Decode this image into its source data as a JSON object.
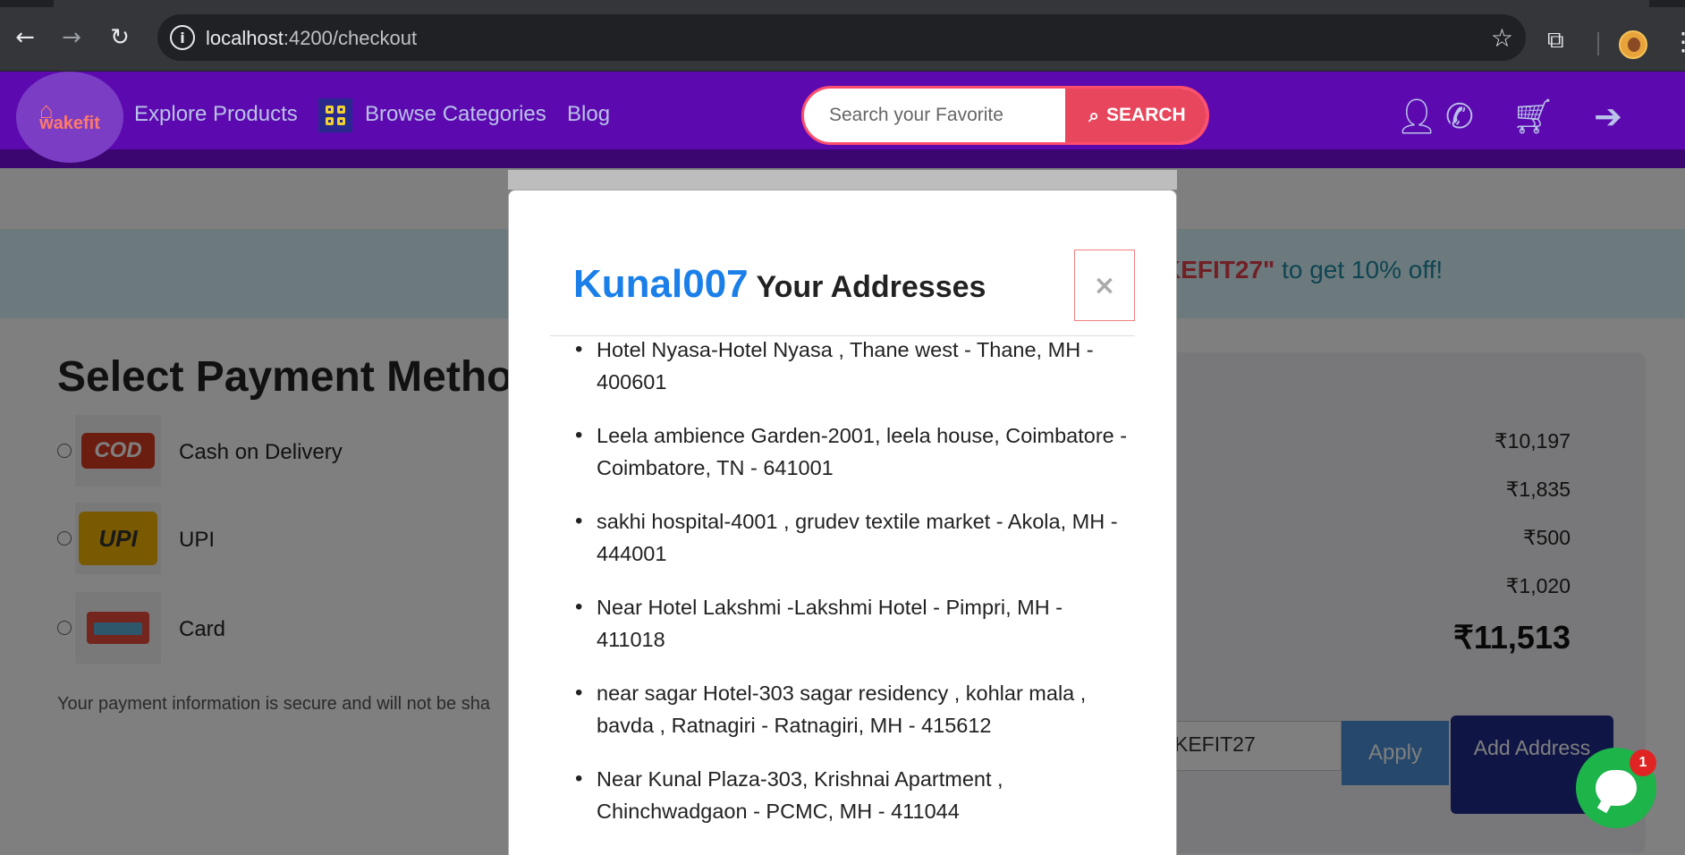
{
  "browser": {
    "url_host": "localhost",
    "url_rest": ":4200/checkout",
    "back_icon": "arrow-left-icon",
    "forward_icon": "arrow-right-icon",
    "reload_icon": "reload-icon"
  },
  "navbar": {
    "logo_text": "wakefit",
    "explore": "Explore Products",
    "browse": "Browse Categories",
    "blog": "Blog",
    "search_placeholder": "Search your Favorite",
    "search_button": "SEARCH",
    "icons": [
      "user-icon",
      "phone-icon",
      "cart-icon",
      "sign-in-icon"
    ]
  },
  "page": {
    "promo_highlight": "KEFIT27\"",
    "promo_rest": " to get 10% off!",
    "payment_title": "Select Payment Metho",
    "payment_methods": [
      {
        "label": "Cash on Delivery",
        "badge": "COD"
      },
      {
        "label": "UPI",
        "badge": "UPI"
      },
      {
        "label": "Card",
        "badge": ""
      }
    ],
    "secure_note": "Your payment information is secure and will not be sha",
    "prices": [
      "₹10,197",
      "₹1,835",
      "₹500",
      "₹1,020"
    ],
    "total": "₹11,513",
    "coupon_value": "KEFIT27",
    "apply_label": "Apply",
    "add_address_label": "Add Address"
  },
  "modal": {
    "username": "Kunal007",
    "title": " Your Addresses",
    "close_label": "×",
    "addresses": [
      "Hotel Nyasa-Hotel Nyasa , Thane west - Thane, MH - 400601",
      "Leela ambience Garden-2001, leela house, Coimbatore - Coimbatore, TN - 641001",
      "sakhi hospital-4001 , grudev textile market - Akola, MH - 444001",
      "Near Hotel Lakshmi -Lakshmi Hotel - Pimpri, MH - 411018",
      "near sagar Hotel-303 sagar residency , kohlar mala , bavda , Ratnagiri - Ratnagiri, MH - 415612",
      "Near Kunal Plaza-303, Krishnai Apartment , Chinchwadgaon - PCMC, MH - 411044"
    ]
  },
  "chat": {
    "badge_count": "1"
  }
}
